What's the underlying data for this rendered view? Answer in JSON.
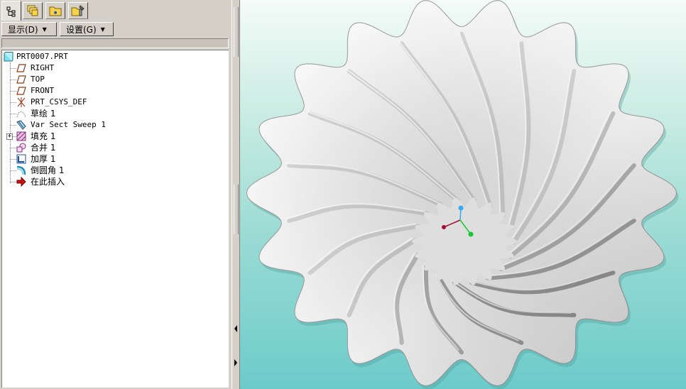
{
  "tabs": [
    {
      "icon": "model-tree-icon",
      "active": true
    },
    {
      "icon": "layers-icon",
      "active": false
    },
    {
      "icon": "folder-icon",
      "active": false
    },
    {
      "icon": "favorites-icon",
      "active": false
    }
  ],
  "menu": {
    "display_label": "显示(D)",
    "settings_label": "设置(G)"
  },
  "tree": {
    "root": "PRT0007.PRT",
    "items": [
      {
        "label": "RIGHT",
        "icon": "datum-plane-icon"
      },
      {
        "label": "TOP",
        "icon": "datum-plane-icon"
      },
      {
        "label": "FRONT",
        "icon": "datum-plane-icon"
      },
      {
        "label": "PRT_CSYS_DEF",
        "icon": "csys-icon"
      },
      {
        "label": "草绘 1",
        "icon": "sketch-icon"
      },
      {
        "label": "Var Sect Sweep 1",
        "icon": "sweep-icon"
      },
      {
        "label": "填充 1",
        "icon": "fill-icon"
      },
      {
        "label": "合并 1",
        "icon": "merge-icon"
      },
      {
        "label": "加厚 1",
        "icon": "thicken-icon"
      },
      {
        "label": "倒圆角 1",
        "icon": "round-icon"
      },
      {
        "label": "在此插入",
        "icon": "insert-here-arrow-icon"
      }
    ]
  },
  "colors": {
    "panel_bg": "#d4d0c8",
    "viewport_top": "#f4fbf8",
    "viewport_bottom": "#6ccbca",
    "axis_x": "#a0103a",
    "axis_y": "#18c830",
    "axis_z": "#3aa8f0"
  }
}
